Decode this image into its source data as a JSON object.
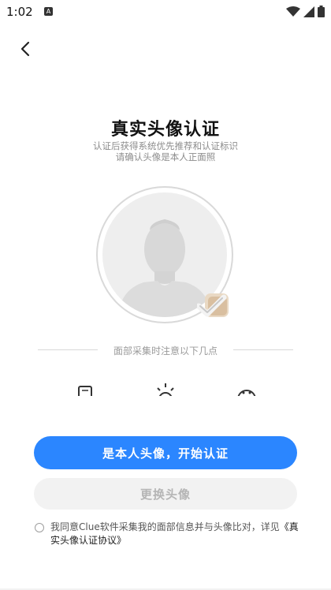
{
  "status_bar": {
    "time": "1:02",
    "app_badge": "A"
  },
  "nav": {
    "back_icon": "chevron-left-icon"
  },
  "header": {
    "title": "真实头像认证",
    "subtitle_line1": "认证后获得系统优先推荐和认证标识",
    "subtitle_line2": "请确认头像是本人正面照"
  },
  "tips": {
    "divider_label": "面部采集时注意以下几点",
    "icons": [
      "phone-icon",
      "brightness-icon",
      "face-icon"
    ]
  },
  "actions": {
    "primary_label": "是本人头像，开始认证",
    "secondary_label": "更换头像"
  },
  "agreement": {
    "text": "我同意Clue软件采集我的面部信息并与头像比对，详见",
    "link": "《真实头像认证协议》"
  },
  "colors": {
    "primary": "#2b86ff",
    "secondary_bg": "#f2f2f2",
    "muted_text": "#8c8c8c"
  }
}
